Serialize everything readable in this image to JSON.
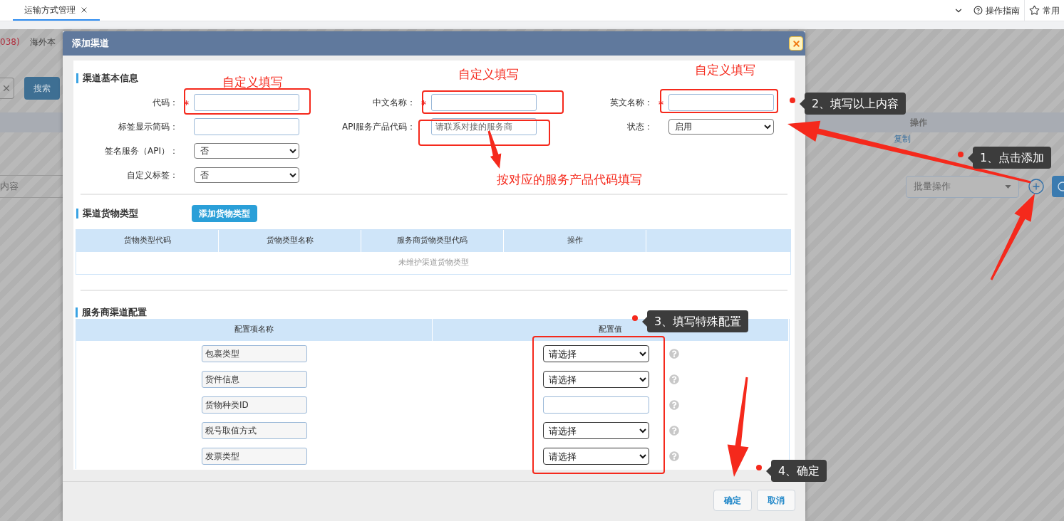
{
  "tabs": [
    {
      "label": "运输方式管理",
      "selected": true
    }
  ],
  "top_actions": [
    {
      "kind": "help",
      "label": "操作指南"
    },
    {
      "kind": "star",
      "label": "常用"
    }
  ],
  "background": {
    "status_text": "038)",
    "location_text": "海外本",
    "search_button": "搜索",
    "filter_placeholder": "内容",
    "column_header": "操作",
    "row_link": "复制",
    "bulk_select": "批量操作"
  },
  "dialog": {
    "title": "添加渠道",
    "basic": {
      "title": "渠道基本信息",
      "rows": [
        [
          {
            "label": "代码：",
            "required": true,
            "kind": "input"
          },
          {
            "label": "中文名称：",
            "required": true,
            "kind": "input"
          },
          {
            "label": "英文名称：",
            "required": true,
            "kind": "input"
          }
        ],
        [
          {
            "label": "标签显示简码：",
            "required": false,
            "kind": "input"
          },
          {
            "label": "API服务产品代码：",
            "required": false,
            "kind": "input",
            "placeholder": "请联系对接的服务商"
          },
          {
            "label": "状态：",
            "required": false,
            "kind": "select",
            "value": "启用"
          }
        ],
        [
          {
            "label": "签名服务（API）：",
            "required": false,
            "kind": "select",
            "value": "否"
          }
        ],
        [
          {
            "label": "自定义标签：",
            "required": false,
            "kind": "select",
            "value": "否"
          }
        ]
      ]
    },
    "cargo": {
      "title": "渠道货物类型",
      "add_button": "添加货物类型",
      "columns": [
        "货物类型代码",
        "货物类型名称",
        "服务商货物类型代码",
        "操作"
      ],
      "empty_text": "未维护渠道货物类型"
    },
    "config": {
      "title": "服务商渠道配置",
      "columns": [
        "配置项名称",
        "配置值"
      ],
      "rows": [
        {
          "name": "包裹类型",
          "kind": "select",
          "value": "请选择"
        },
        {
          "name": "货件信息",
          "kind": "select",
          "value": "请选择"
        },
        {
          "name": "货物种类ID",
          "kind": "input"
        },
        {
          "name": "税号取值方式",
          "kind": "select",
          "value": "请选择"
        },
        {
          "name": "发票类型",
          "kind": "select",
          "value": "请选择"
        }
      ]
    },
    "buttons": [
      {
        "label": "确定"
      },
      {
        "label": "取消"
      }
    ]
  },
  "annotations": {
    "notes": [
      {
        "text": "自定义填写"
      },
      {
        "text": "自定义填写"
      },
      {
        "text": "自定义填写"
      },
      {
        "text": "按对应的服务产品代码填写"
      }
    ],
    "callouts": [
      {
        "text": "2、填写以上内容"
      },
      {
        "text": "1、点击添加"
      },
      {
        "text": "3、填写特殊配置"
      },
      {
        "text": "4、确定"
      }
    ]
  }
}
